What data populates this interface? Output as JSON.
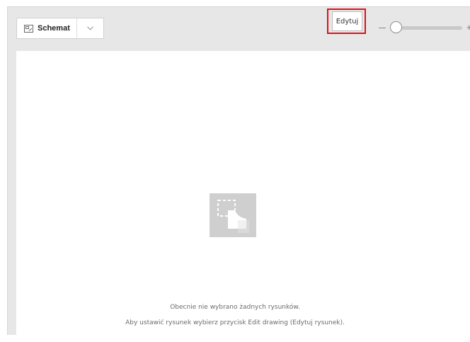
{
  "toolbar": {
    "view_selector": {
      "label": "Schemat",
      "icon": "diagram-icon"
    },
    "edit_button": {
      "label": "Edytuj",
      "highlighted": true,
      "highlight_color": "#e0101a"
    },
    "zoom": {
      "minus_label": "−",
      "plus_label": "+"
    }
  },
  "canvas": {
    "empty_icon": "drawing-placeholder-icon",
    "message_line1": "Obecnie nie wybrano żadnych rysunków.",
    "message_line2": "Aby ustawić rysunek wybierz przycisk Edit drawing (Edytuj rysunek)."
  }
}
